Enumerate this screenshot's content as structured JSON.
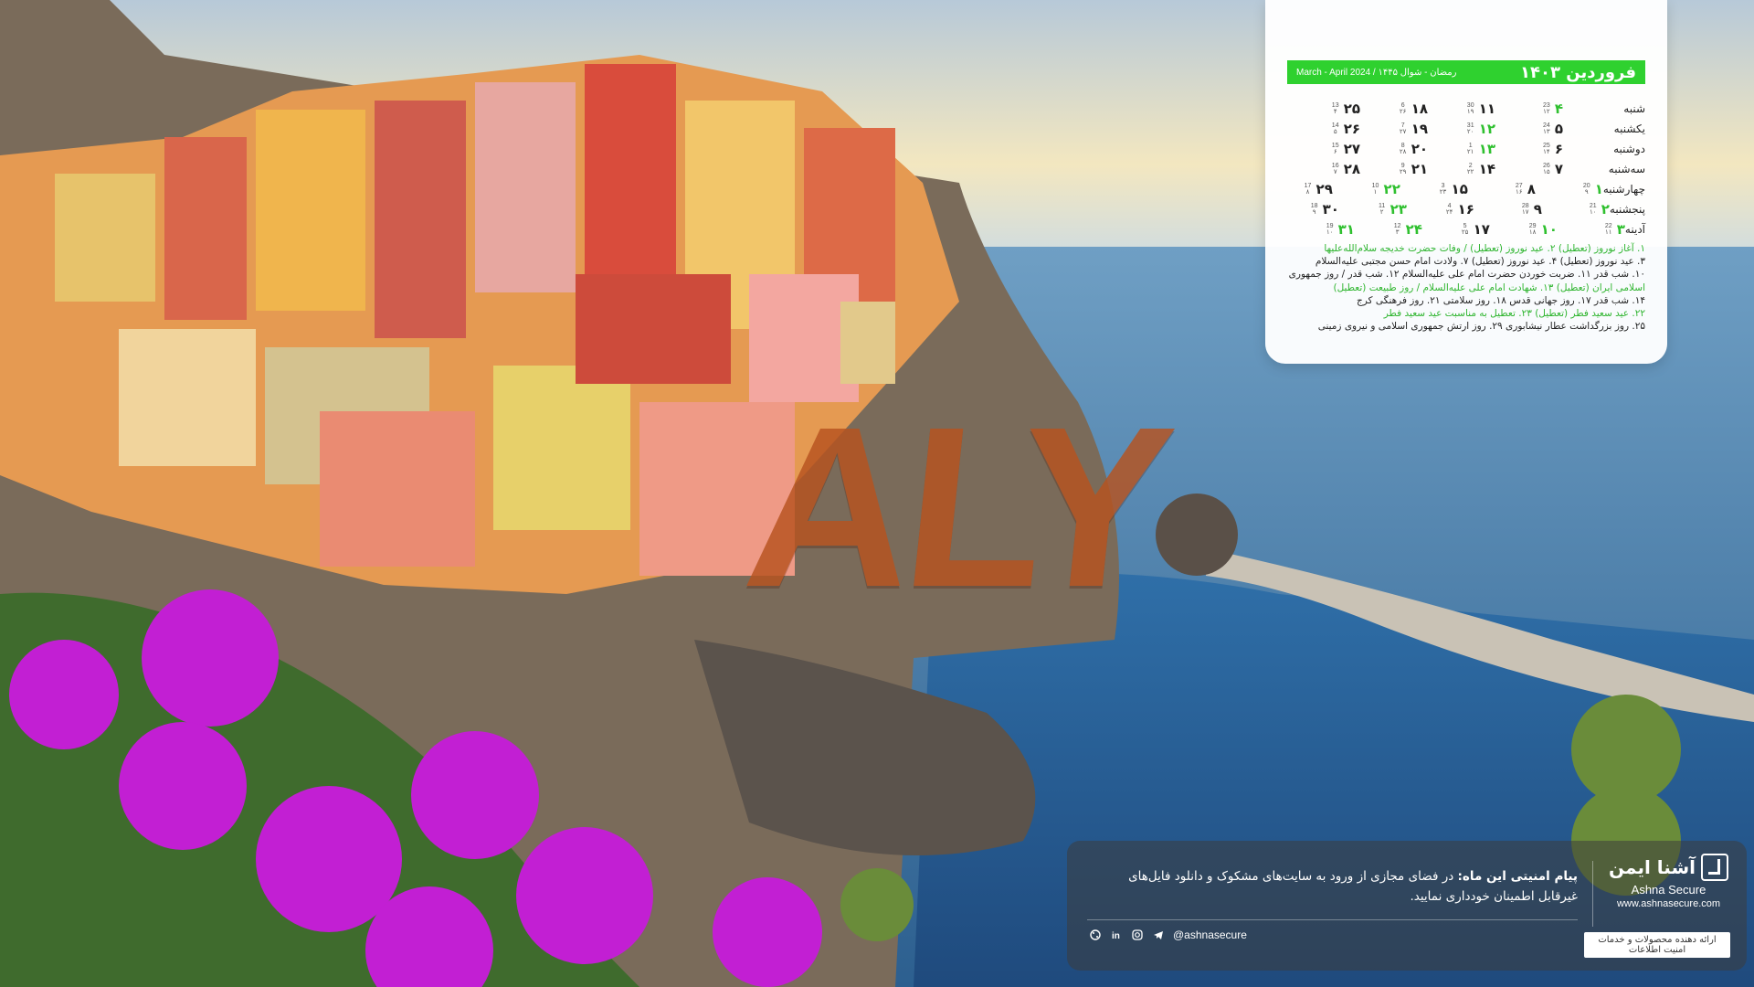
{
  "wallpaper": {
    "overlay_word": "ALY"
  },
  "calendar": {
    "title": "فروردین ۱۴۰۳",
    "subtitle": "March - April 2024 / رمضان - شوال ۱۴۴۵",
    "header_color": "#2fd12f",
    "rows": [
      {
        "day": "شنبه",
        "cells": [
          {
            "n": "۴",
            "g1": "23",
            "g2": "۱۲",
            "holiday": true
          },
          {
            "n": "۱۱",
            "g1": "30",
            "g2": "۱۹",
            "holiday": false
          },
          {
            "n": "۱۸",
            "g1": "6",
            "g2": "۲۶",
            "holiday": false
          },
          {
            "n": "۲۵",
            "g1": "13",
            "g2": "۴",
            "holiday": false
          }
        ]
      },
      {
        "day": "یکشنبه",
        "cells": [
          {
            "n": "۵",
            "g1": "24",
            "g2": "۱۳",
            "holiday": false
          },
          {
            "n": "۱۲",
            "g1": "31",
            "g2": "۲۰",
            "holiday": true
          },
          {
            "n": "۱۹",
            "g1": "7",
            "g2": "۲۷",
            "holiday": false
          },
          {
            "n": "۲۶",
            "g1": "14",
            "g2": "۵",
            "holiday": false
          }
        ]
      },
      {
        "day": "دوشنبه",
        "cells": [
          {
            "n": "۶",
            "g1": "25",
            "g2": "۱۴",
            "holiday": false
          },
          {
            "n": "۱۳",
            "g1": "1",
            "g2": "۲۱",
            "holiday": true
          },
          {
            "n": "۲۰",
            "g1": "8",
            "g2": "۲۸",
            "holiday": false
          },
          {
            "n": "۲۷",
            "g1": "15",
            "g2": "۶",
            "holiday": false
          }
        ]
      },
      {
        "day": "سه‌شنبه",
        "cells": [
          {
            "n": "۷",
            "g1": "26",
            "g2": "۱۵",
            "holiday": false
          },
          {
            "n": "۱۴",
            "g1": "2",
            "g2": "۲۲",
            "holiday": false
          },
          {
            "n": "۲۱",
            "g1": "9",
            "g2": "۲۹",
            "holiday": false
          },
          {
            "n": "۲۸",
            "g1": "16",
            "g2": "۷",
            "holiday": false
          }
        ]
      },
      {
        "day": "چهارشنبه",
        "cells": [
          {
            "n": "۱",
            "g1": "20",
            "g2": "۹",
            "holiday": true
          },
          {
            "n": "۸",
            "g1": "27",
            "g2": "۱۶",
            "holiday": false
          },
          {
            "n": "۱۵",
            "g1": "3",
            "g2": "۲۳",
            "holiday": false
          },
          {
            "n": "۲۲",
            "g1": "10",
            "g2": "۱",
            "holiday": true
          },
          {
            "n": "۲۹",
            "g1": "17",
            "g2": "۸",
            "holiday": false
          }
        ]
      },
      {
        "day": "پنجشنبه",
        "cells": [
          {
            "n": "۲",
            "g1": "21",
            "g2": "۱۰",
            "holiday": true
          },
          {
            "n": "۹",
            "g1": "28",
            "g2": "۱۷",
            "holiday": false
          },
          {
            "n": "۱۶",
            "g1": "4",
            "g2": "۲۴",
            "holiday": false
          },
          {
            "n": "۲۳",
            "g1": "11",
            "g2": "۲",
            "holiday": true
          },
          {
            "n": "۳۰",
            "g1": "18",
            "g2": "۹",
            "holiday": false
          }
        ]
      },
      {
        "day": "آدینه",
        "cells": [
          {
            "n": "۳",
            "g1": "22",
            "g2": "۱۱",
            "holiday": true
          },
          {
            "n": "۱۰",
            "g1": "29",
            "g2": "۱۸",
            "holiday": true
          },
          {
            "n": "۱۷",
            "g1": "5",
            "g2": "۲۵",
            "holiday": false
          },
          {
            "n": "۲۴",
            "g1": "12",
            "g2": "۳",
            "holiday": true
          },
          {
            "n": "۳۱",
            "g1": "19",
            "g2": "۱۰",
            "holiday": true
          }
        ]
      }
    ],
    "events": [
      {
        "text": "۱. آغاز نوروز (تعطیل) ۲. عید نوروز (تعطیل) / وفات حضرت خدیجه سلام‌الله‌علیها",
        "holiday": true
      },
      {
        "text": "۳. عید نوروز (تعطیل) ۴. عید نوروز (تعطیل) ۷. ولادت امام حسن مجتبی علیه‌السلام",
        "holiday": false
      },
      {
        "text": "۱۰. شب قدر ۱۱. ضربت خوردن حضرت امام علی علیه‌السلام ۱۲. شب قدر / روز جمهوری",
        "holiday": false
      },
      {
        "text": "اسلامی ایران (تعطیل) ۱۳. شهادت امام علی علیه‌السلام / روز طبیعت (تعطیل)",
        "holiday": true
      },
      {
        "text": "۱۴. شب قدر ۱۷. روز جهانی قدس ۱۸. روز سلامتی ۲۱. روز فرهنگی کرج",
        "holiday": false
      },
      {
        "text": "۲۲. عید سعید فطر (تعطیل) ۲۳. تعطیل به مناسبت عید سعید فطر",
        "holiday": true
      },
      {
        "text": "۲۵. روز بزرگداشت عطار نیشابوری ۲۹. روز ارتش جمهوری اسلامی و نیروی زمینی",
        "holiday": false
      }
    ]
  },
  "banner": {
    "brand_fa": "آشنا ایمن",
    "brand_en": "Ashna Secure",
    "brand_url": "www.ashnasecure.com",
    "tagline": "ارائه دهنده محصولات و خدمات امنیت اطلاعات",
    "message_title": "پیام امنیتی این ماه:",
    "message_body": " در فضای مجازی از ورود به سایت‌های مشکوک و دانلود فایل‌های غیرقابل اطمینان خودداری نمایید.",
    "social_handle": "@ashnasecure",
    "social_icons": [
      "telegram-icon",
      "instagram-icon",
      "linkedin-icon",
      "aparat-icon"
    ]
  }
}
